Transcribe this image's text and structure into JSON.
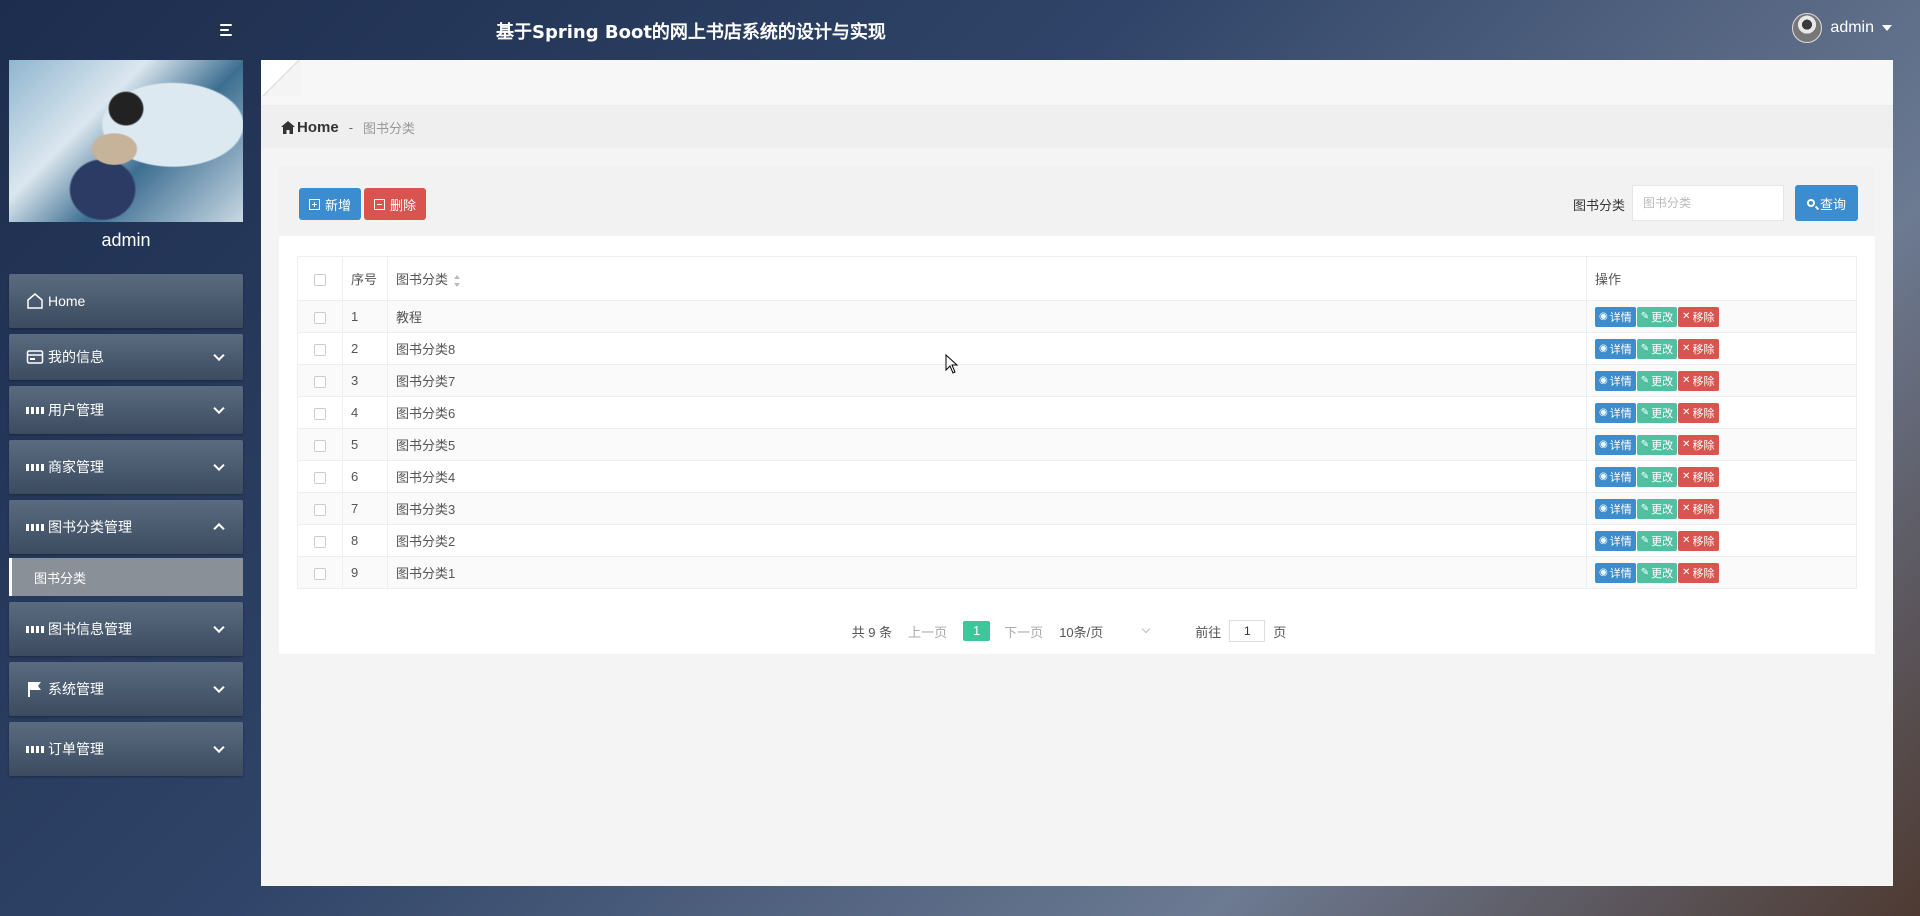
{
  "header": {
    "title": "基于Spring Boot的网上书店系统的设计与实现",
    "user_name": "admin"
  },
  "sidebar": {
    "profile_name": "admin",
    "items": [
      {
        "label": "Home",
        "icon": "home-icon"
      },
      {
        "label": "我的信息",
        "icon": "card-icon"
      },
      {
        "label": "用户管理",
        "icon": "grid-icon"
      },
      {
        "label": "商家管理",
        "icon": "grid-icon"
      },
      {
        "label": "图书分类管理",
        "icon": "grid-icon"
      },
      {
        "label": "图书信息管理",
        "icon": "grid-icon"
      },
      {
        "label": "系统管理",
        "icon": "flag-icon"
      },
      {
        "label": "订单管理",
        "icon": "grid-icon"
      }
    ],
    "sub_items": [
      {
        "label": "图书分类"
      }
    ]
  },
  "breadcrumb": {
    "home": "Home",
    "separator": "-",
    "current": "图书分类"
  },
  "toolbar": {
    "add_label": "新增",
    "delete_label": "删除",
    "search_label": "图书分类",
    "search_placeholder": "图书分类",
    "search_button": "查询"
  },
  "table": {
    "columns": [
      "序号",
      "图书分类",
      "操作"
    ],
    "actions": {
      "detail": "详情",
      "edit": "更改",
      "remove": "移除"
    },
    "rows": [
      {
        "index": "1",
        "category": "教程"
      },
      {
        "index": "2",
        "category": "图书分类8"
      },
      {
        "index": "3",
        "category": "图书分类7"
      },
      {
        "index": "4",
        "category": "图书分类6"
      },
      {
        "index": "5",
        "category": "图书分类5"
      },
      {
        "index": "6",
        "category": "图书分类4"
      },
      {
        "index": "7",
        "category": "图书分类3"
      },
      {
        "index": "8",
        "category": "图书分类2"
      },
      {
        "index": "9",
        "category": "图书分类1"
      }
    ]
  },
  "pagination": {
    "total": "共 9 条",
    "prev": "上一页",
    "current_page": "1",
    "next": "下一页",
    "page_size": "10条/页",
    "goto_label": "前往",
    "goto_value": "1",
    "page_suffix": "页"
  },
  "colors": {
    "primary": "#3b8dcf",
    "success": "#4fc1a1",
    "danger": "#d9534f",
    "active_page": "#3cc79a"
  }
}
